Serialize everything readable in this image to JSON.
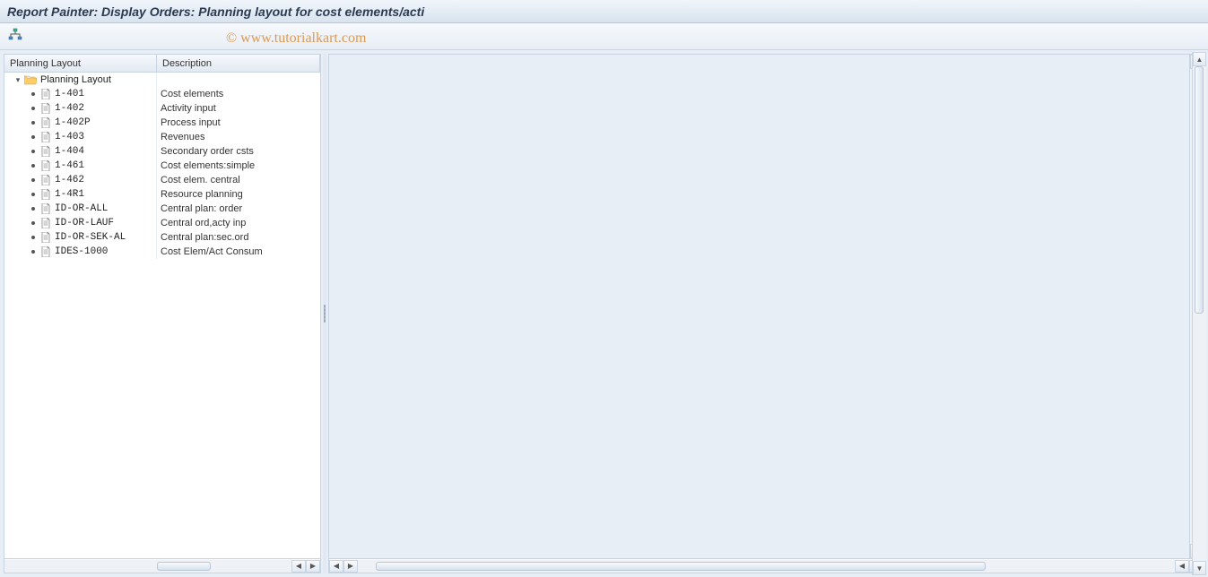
{
  "title": "Report Painter: Display Orders: Planning layout for cost elements/acti",
  "watermark": "© www.tutorialkart.com",
  "tree": {
    "headers": {
      "layout": "Planning Layout",
      "description": "Description"
    },
    "root": {
      "label": "Planning Layout",
      "description": ""
    },
    "items": [
      {
        "code": "1-401",
        "desc": "Cost elements"
      },
      {
        "code": "1-402",
        "desc": "Activity input"
      },
      {
        "code": "1-402P",
        "desc": "Process input"
      },
      {
        "code": "1-403",
        "desc": "Revenues"
      },
      {
        "code": "1-404",
        "desc": "Secondary order csts"
      },
      {
        "code": "1-461",
        "desc": "Cost elements:simple"
      },
      {
        "code": "1-462",
        "desc": "Cost elem. central"
      },
      {
        "code": "1-4R1",
        "desc": "Resource planning"
      },
      {
        "code": "ID-OR-ALL",
        "desc": "Central plan: order"
      },
      {
        "code": "ID-OR-LAUF",
        "desc": "Central ord,acty inp"
      },
      {
        "code": "ID-OR-SEK-AL",
        "desc": "Central plan:sec.ord"
      },
      {
        "code": "IDES-1000",
        "desc": "Cost Elem/Act Consum"
      }
    ]
  }
}
